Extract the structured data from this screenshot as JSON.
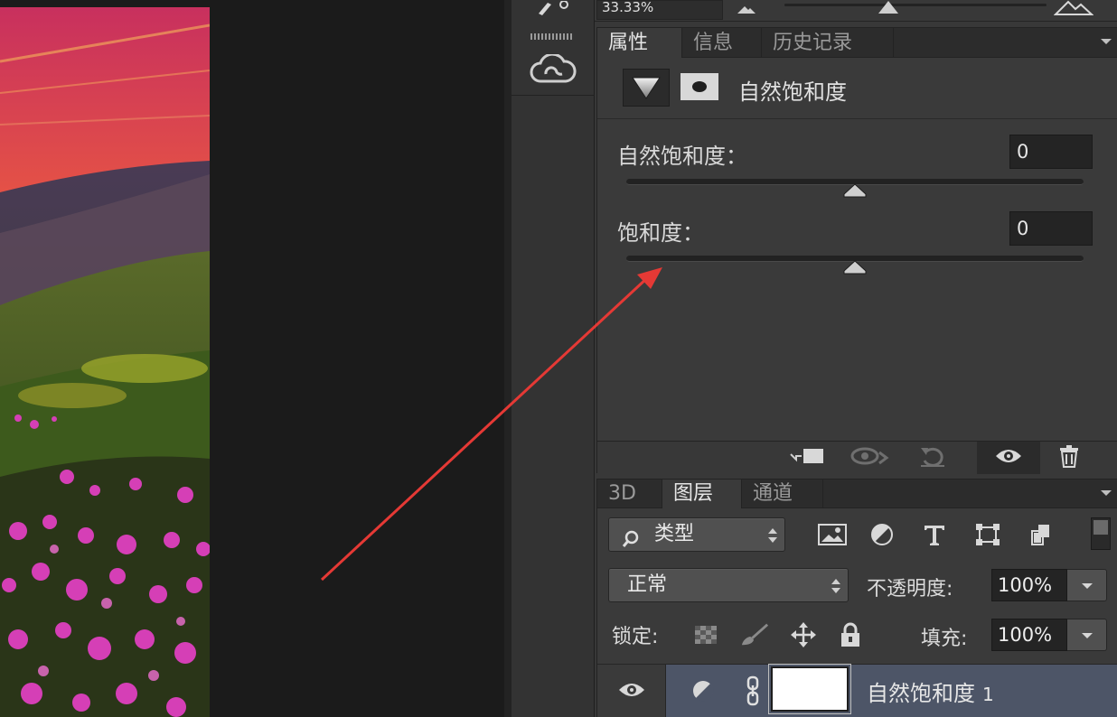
{
  "canvas": {
    "image": "mountain-sunset-flowers-photo"
  },
  "toolbar": {
    "tools": [
      "brush-tool-icon",
      "creative-cloud-icon"
    ]
  },
  "navigator": {
    "zoom": "33.33%",
    "icons": [
      "zoom-out-mountain-icon",
      "zoom-in-mountain-icon"
    ]
  },
  "properties_panel": {
    "tabs": [
      {
        "label": "属性",
        "active": true
      },
      {
        "label": "信息",
        "active": false
      },
      {
        "label": "历史记录",
        "active": false
      }
    ],
    "adjustment_title": "自然饱和度",
    "adjustment_icon": "vibrance-triangle-icon",
    "mask_icon": "layer-mask-icon",
    "vibrance": {
      "label": "自然饱和度：",
      "value": "0",
      "slider_position": 0.5
    },
    "saturation": {
      "label": "饱和度：",
      "value": "0",
      "slider_position": 0.5
    },
    "footer_icons": [
      "clip-to-layer-icon",
      "view-previous-state-icon",
      "reset-icon",
      "visibility-eye-icon",
      "trash-icon"
    ]
  },
  "layers_panel": {
    "tabs": [
      {
        "label": "3D",
        "active": false
      },
      {
        "label": "图层",
        "active": true
      },
      {
        "label": "通道",
        "active": false
      }
    ],
    "filter_kind": "类型",
    "filter_icons": [
      "image-filter-icon",
      "adjustment-filter-icon",
      "type-filter-icon",
      "shape-filter-icon",
      "smart-object-filter-icon"
    ],
    "blend_mode": "正常",
    "opacity_label": "不透明度:",
    "opacity": "100%",
    "lock_label": "锁定:",
    "lock_icons": [
      "lock-transparent-pixels-icon",
      "lock-image-pixels-icon",
      "lock-position-icon",
      "lock-all-icon"
    ],
    "fill_label": "填充:",
    "fill": "100%",
    "layer": {
      "name": "自然饱和度",
      "number": "1"
    }
  },
  "annotation": {
    "type": "red-arrow",
    "color": "#e53935"
  },
  "colors": {
    "panel_bg": "#383838",
    "selected_layer": "#4d5567",
    "arrow": "#e53935"
  }
}
